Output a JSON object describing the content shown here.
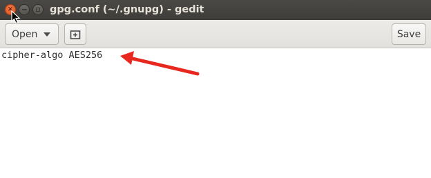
{
  "window": {
    "title": "gpg.conf (~/.gnupg) - gedit",
    "close_icon": "×"
  },
  "toolbar": {
    "open_label": "Open",
    "new_document_icon": "new-document-icon",
    "save_label": "Save"
  },
  "editor": {
    "lines": [
      "cipher-algo AES256"
    ]
  },
  "colors": {
    "titlebar": "#3e3d39",
    "close_button": "#e0531c",
    "annotation_arrow": "#e8271f"
  }
}
